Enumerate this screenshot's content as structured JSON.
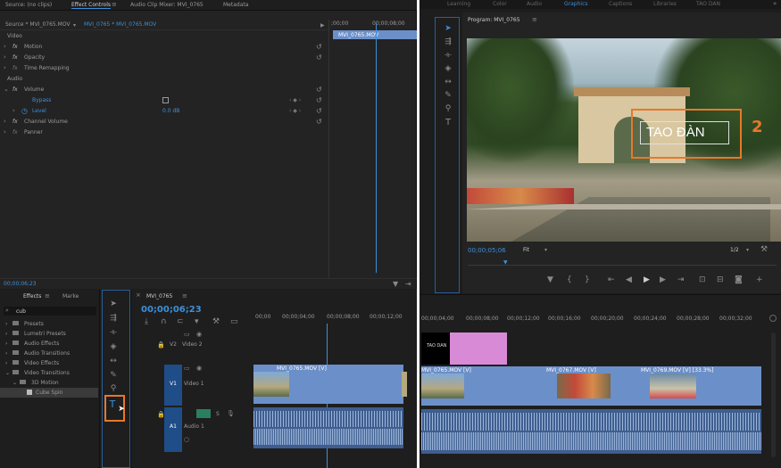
{
  "left": {
    "tabs": [
      "Source: (no clips)",
      "Effect Controls",
      "Audio Clip Mixer: MVI_0765",
      "Metadata"
    ],
    "subheader": {
      "source": "Source * MVI_0765.MOV",
      "seq": "MVI_0765 * MVI_0765.MOV"
    },
    "mini_timeline": {
      "t0": ";00;00",
      "t1": "00;00;08;00",
      "clip": "MVI_0765.MOV"
    },
    "sections": {
      "video": "Video",
      "audio": "Audio"
    },
    "effects": [
      {
        "indent": 0,
        "fx": true,
        "label": "Motion",
        "reset": true
      },
      {
        "indent": 0,
        "fx": true,
        "label": "Opacity",
        "reset": true
      },
      {
        "indent": 0,
        "fx": true,
        "label": "Time Remapping",
        "reset": false
      },
      {
        "indent": 0,
        "fx": true,
        "label": "Volume",
        "reset": true
      },
      {
        "indent": 1,
        "fx": false,
        "label": "Bypass",
        "reset": true
      },
      {
        "indent": 1,
        "fx": false,
        "label": "Level",
        "reset": true,
        "value": "0.0 dB"
      },
      {
        "indent": 0,
        "fx": true,
        "label": "Channel Volume",
        "reset": true
      },
      {
        "indent": 0,
        "fx": true,
        "label": "Panner",
        "reset": false
      }
    ],
    "timecode": "00;00;06;23"
  },
  "effects_panel": {
    "tabs": [
      "Effects",
      "Marke"
    ],
    "search_value": "cub",
    "tree": [
      {
        "label": "Presets",
        "indent": 0
      },
      {
        "label": "Lumetri Presets",
        "indent": 0
      },
      {
        "label": "Audio Effects",
        "indent": 0
      },
      {
        "label": "Audio Transitions",
        "indent": 0
      },
      {
        "label": "Video Effects",
        "indent": 0
      },
      {
        "label": "Video Transitions",
        "indent": 0
      },
      {
        "label": "3D Motion",
        "indent": 1
      },
      {
        "label": "Cube Spin",
        "indent": 2
      }
    ]
  },
  "tools": [
    "selection",
    "track-select",
    "ripple",
    "razor",
    "slip",
    "pen",
    "hand",
    "type"
  ],
  "annotations": {
    "one": "1",
    "two": "2"
  },
  "timeline": {
    "tab": "MVI_0765",
    "timecode": "00;00;06;23",
    "ruler_left": [
      "00;00",
      "00;00;04;00",
      "00;00;08;00",
      "00;00;12;00"
    ],
    "ruler_right": [
      "00;00;04;00",
      "00;00;08;00",
      "00;00;12;00",
      "00;00;16;00",
      "00;00;20;00",
      "00;00;24;00",
      "00;00;28;00",
      "00;00;32;00"
    ],
    "tracks": {
      "v2": "V2",
      "v1": "V1",
      "a1": "A1",
      "v2_name": "Video 2",
      "v1_name": "Video 1",
      "a1_name": "Audio 1"
    },
    "clips": {
      "c1": "MVI_0765.MOV [V]",
      "c2": "MVI_0765.MOV [V]",
      "c3": "MVI_0767.MOV [V]",
      "c4": "MVI_0769.MOV [V] [33.3%]",
      "title": "TAO DAN"
    }
  },
  "program": {
    "workspaces": [
      "Learning",
      "Color",
      "Audio",
      "Graphics",
      "Captions",
      "Libraries",
      "TAO DAN"
    ],
    "title": "Program: MVI_0765",
    "overlay_text": "TAO ĐÀN",
    "timecode": "00;00;05;06",
    "fit": "Fit",
    "scale": "1/2"
  },
  "colors": {
    "accent_blue": "#3d8fd9",
    "highlight_orange": "#e8782a",
    "clip_blue": "#6b8fc9",
    "title_pink": "#d98ad6",
    "audio_green": "#2a7f5e"
  }
}
